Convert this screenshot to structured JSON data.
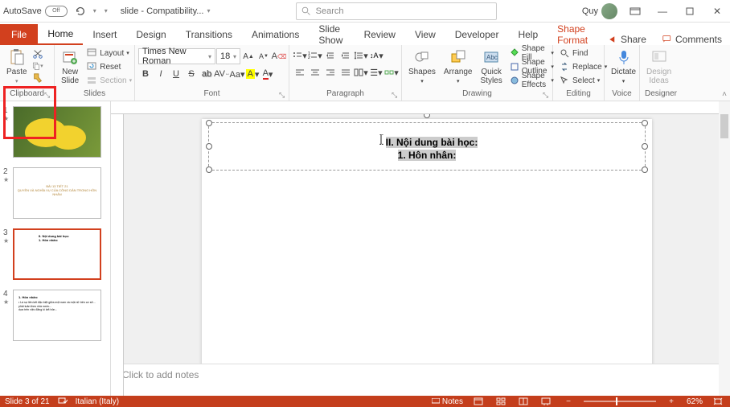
{
  "titlebar": {
    "autosave_label": "AutoSave",
    "autosave_state": "Off",
    "doc_title": "slide  -  Compatibility...",
    "search_placeholder": "Search",
    "user_name": "Quy"
  },
  "tabs": {
    "file": "File",
    "home": "Home",
    "insert": "Insert",
    "design": "Design",
    "transitions": "Transitions",
    "animations": "Animations",
    "slideshow": "Slide Show",
    "review": "Review",
    "view": "View",
    "developer": "Developer",
    "help": "Help",
    "shape_format": "Shape Format",
    "share": "Share",
    "comments": "Comments"
  },
  "ribbon": {
    "clipboard": {
      "label": "Clipboard",
      "paste": "Paste"
    },
    "slides": {
      "label": "Slides",
      "new_slide": "New\nSlide",
      "layout": "Layout",
      "reset": "Reset",
      "section": "Section"
    },
    "font": {
      "label": "Font",
      "font_name": "Times New Roman",
      "font_size": "18"
    },
    "paragraph": {
      "label": "Paragraph"
    },
    "drawing": {
      "label": "Drawing",
      "shapes": "Shapes",
      "arrange": "Arrange",
      "quick_styles": "Quick\nStyles",
      "shape_fill": "Shape Fill",
      "shape_outline": "Shape Outline",
      "shape_effects": "Shape Effects"
    },
    "editing": {
      "label": "Editing",
      "find": "Find",
      "replace": "Replace",
      "select": "Select"
    },
    "voice": {
      "label": "Voice",
      "dictate": "Dictate"
    },
    "designer": {
      "label": "Designer",
      "design_ideas": "Design\nIdeas"
    }
  },
  "slide_content": {
    "line1": "II. Nội dung bài học:",
    "line2": "1. Hôn nhân:"
  },
  "thumbnails": [
    {
      "num": "1",
      "title_a": "",
      "title_b": ""
    },
    {
      "num": "2",
      "title_a": "BÀI 13 TIẾT 21",
      "title_b": "QUYỀN VÀ NGHĨA VỤ CỦA CÔNG DÂN TRONG HÔN NHÂN"
    },
    {
      "num": "3",
      "title_a": "",
      "title_b": ""
    },
    {
      "num": "4",
      "title_a": "1. Hôn nhân:",
      "title_b": ""
    }
  ],
  "notes_placeholder": "Click to add notes",
  "status": {
    "slide_of": "Slide 3 of 21",
    "language": "Italian (Italy)",
    "notes_btn": "Notes",
    "zoom": "62%"
  }
}
